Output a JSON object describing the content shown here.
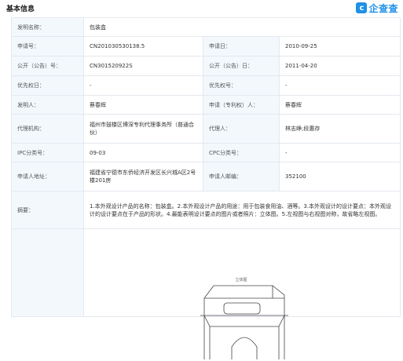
{
  "header": {
    "section_title": "基本信息",
    "brand_icon": "c",
    "brand_text": "企查查"
  },
  "rows": {
    "invention_name": {
      "label": "发明名称：",
      "value": "包装盒"
    },
    "application_no": {
      "label": "申请号：",
      "value": "CN201030530138.5"
    },
    "application_date": {
      "label": "申请日：",
      "value": "2010-09-25"
    },
    "publication_no": {
      "label": "公开（公告）号：",
      "value": "CN301520922S"
    },
    "publication_date": {
      "label": "公开（公告）日：",
      "value": "2011-04-20"
    },
    "priority_date": {
      "label": "优先权日：",
      "value": "-"
    },
    "priority_no": {
      "label": "优先权号：",
      "value": "-"
    },
    "inventor": {
      "label": "发明人：",
      "value": "蔡春辉"
    },
    "applicant": {
      "label": "申请（专利权）人：",
      "value": "蔡春辉"
    },
    "agency": {
      "label": "代理机构：",
      "value": "福州市鼓楼区博深专利代理事务所（普通合伙）"
    },
    "agent": {
      "label": "代理人：",
      "value": "林志峥;段惠存"
    },
    "ipc": {
      "label": "IPC分类号：",
      "value": "09-03"
    },
    "cpc": {
      "label": "CPC分类号：",
      "value": "-"
    },
    "address": {
      "label": "申请人地址：",
      "value": "福建省宁德市东侨经济开发区长兴城A区2号楼201房"
    },
    "postcode": {
      "label": "申请人邮编：",
      "value": "352100"
    },
    "abstract": {
      "label": "摘要：",
      "value": "1.本外观设计产品的名称：包装盒。2.本外观设计产品的用途：用于包装食用油、酒等。3.本外观设计的设计要点：本外观设计的设计要点在于产品的形状。4.最能表明设计要点的图片或者照片：立体图。5.左视图与右视图对称，故省略左视图。"
    }
  },
  "drawing": {
    "caption": "立体图"
  }
}
